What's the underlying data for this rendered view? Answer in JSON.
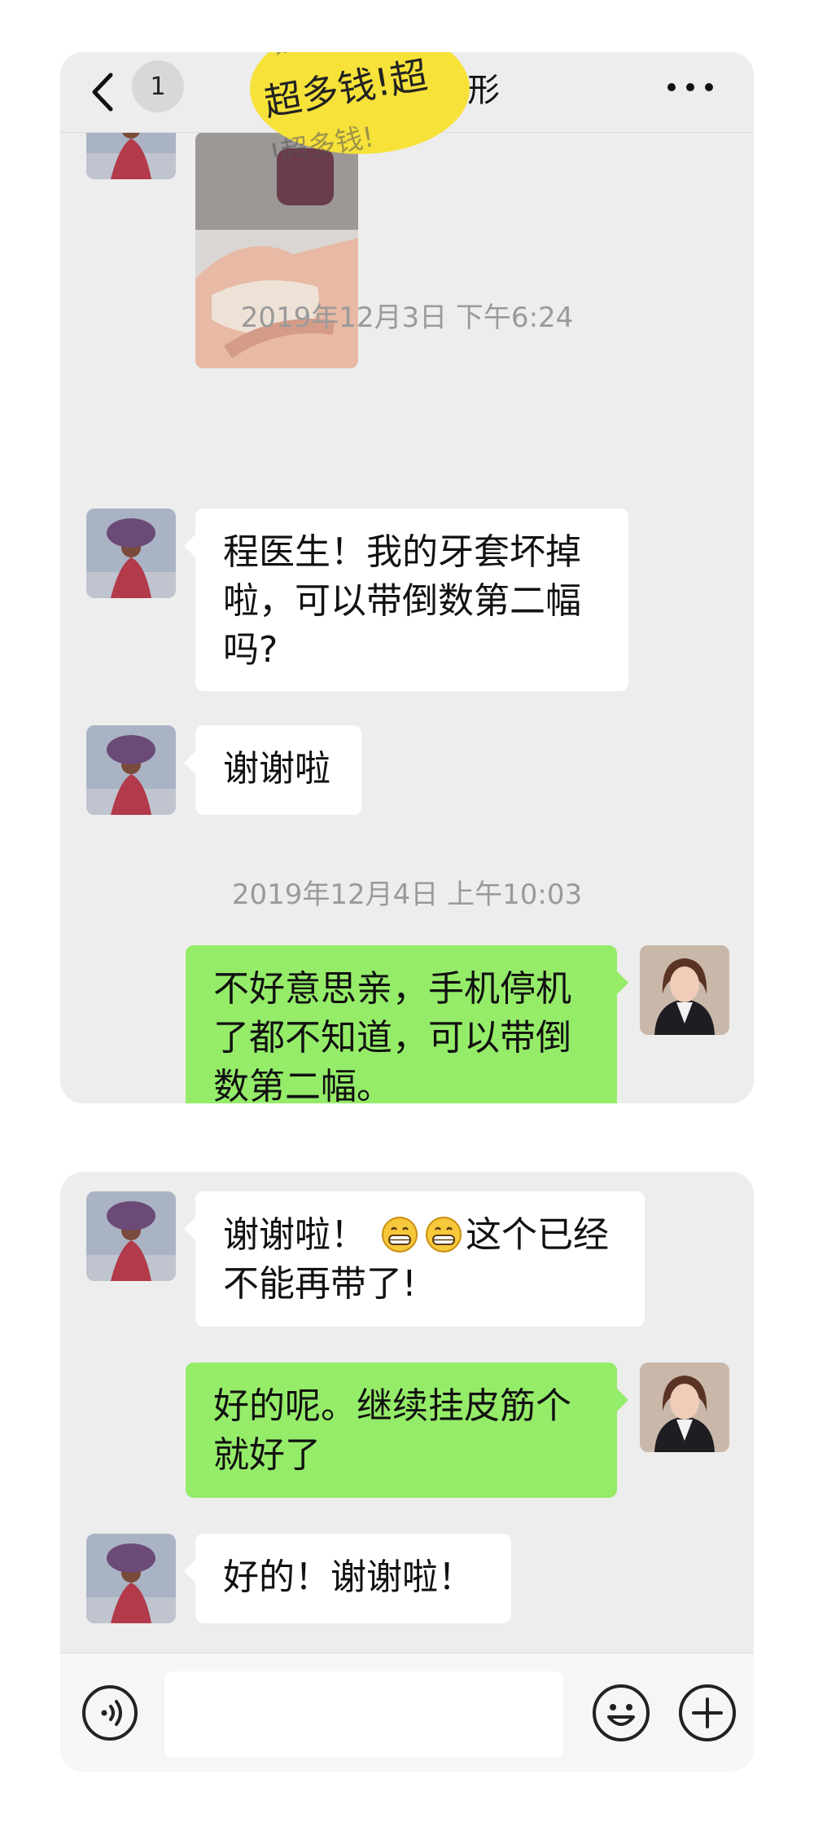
{
  "header": {
    "unread_count": "1",
    "title": "媛隐形",
    "sticker_text": "超多钱!超"
  },
  "chat1": {
    "timestamp_1": "2019年12月3日 下午6:24",
    "msg_1": "程医生！我的牙套坏掉啦，可以带倒数第二幅吗?",
    "msg_2": "谢谢啦",
    "timestamp_2": "2019年12月4日 上午10:03",
    "msg_3": "不好意思亲，手机停机了都不知道，可以带倒数第二幅。"
  },
  "chat2": {
    "msg_4_part_1": "谢谢啦！",
    "msg_4_part_2": "这个已经不能再带了!",
    "msg_5": "好的呢。继续挂皮筋个就好了",
    "msg_6": "好的！谢谢啦！"
  },
  "icons": {
    "back": "chevron-left-icon",
    "more": "more-dots-icon",
    "voice": "voice-icon",
    "emoji": "emoji-icon",
    "plus": "plus-icon",
    "grin": "grin-emoji-icon"
  },
  "colors": {
    "outgoing_bubble": "#95ec69",
    "incoming_bubble": "#ffffff",
    "chat_background": "#ededed",
    "sticker_yellow": "#f7e23a"
  }
}
